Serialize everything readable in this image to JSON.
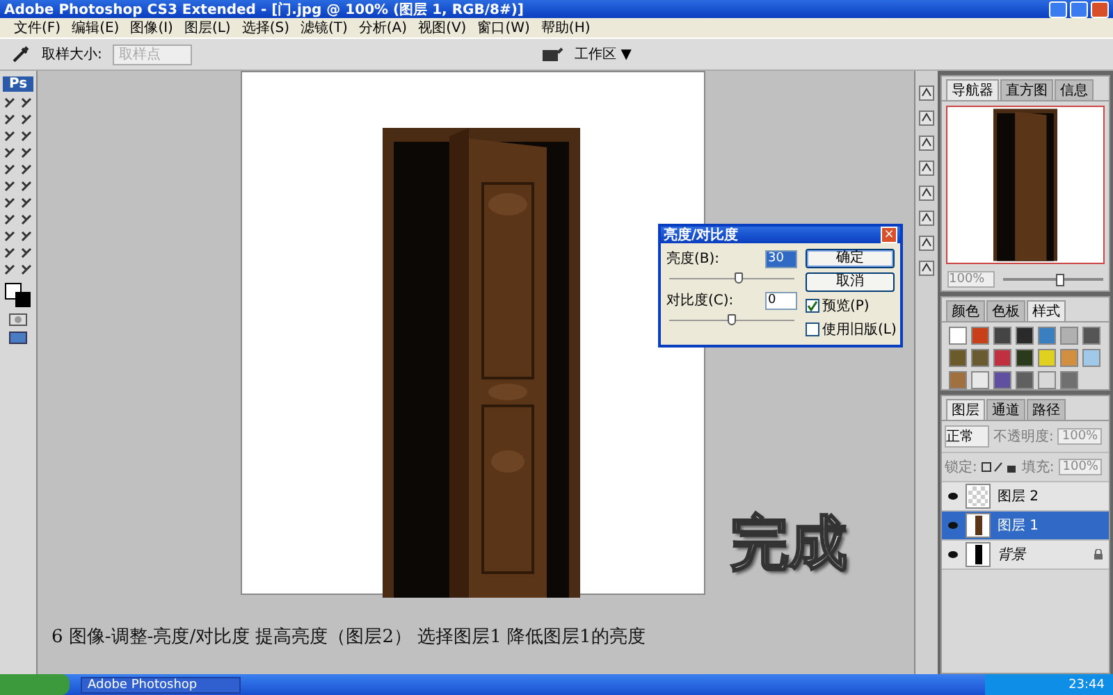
{
  "window": {
    "title": "Adobe Photoshop CS3 Extended - [门.jpg @ 100% (图层 1, RGB/8#)]"
  },
  "menu": [
    "文件(F)",
    "编辑(E)",
    "图像(I)",
    "图层(L)",
    "选择(S)",
    "滤镜(T)",
    "分析(A)",
    "视图(V)",
    "窗口(W)",
    "帮助(H)"
  ],
  "options_bar": {
    "label": "取样大小:",
    "dropdown": {
      "value": "取样点",
      "disabled": true
    },
    "workspace": "工作区 ▼"
  },
  "toolbox": {
    "logo": "Ps"
  },
  "dialog": {
    "title": "亮度/对比度",
    "close": "×",
    "fields": [
      {
        "label": "亮度(B):",
        "value": "30",
        "selected": true,
        "level": 0.55
      },
      {
        "label": "对比度(C):",
        "value": "0",
        "selected": false,
        "level": 0.5
      }
    ],
    "buttons": [
      "确定",
      "取消"
    ],
    "checkboxes": [
      {
        "label": "预览(P)",
        "checked": true
      },
      {
        "label": "使用旧版(L)",
        "checked": false
      }
    ]
  },
  "navigator": {
    "tabs": [
      {
        "label": "导航器",
        "selected": true
      },
      {
        "label": "直方图",
        "selected": false
      },
      {
        "label": "信息",
        "selected": false
      }
    ],
    "zoom": "100%",
    "zoom_slider": {
      "level": 0.55
    }
  },
  "styles": {
    "tabs": [
      {
        "label": "颜色",
        "selected": false
      },
      {
        "label": "色板",
        "selected": false
      },
      {
        "label": "样式",
        "selected": true
      }
    ],
    "swatches": [
      {
        "color": "#ffffff"
      },
      {
        "color": "#c8401a"
      },
      {
        "color": "#444444"
      },
      {
        "color": "#2a2a2a"
      },
      {
        "color": "#3a7fc0"
      },
      {
        "color": "#b0b0b0"
      },
      {
        "color": "#555555"
      },
      {
        "color": "#6b5a2a"
      },
      {
        "color": "#6a5a30"
      },
      {
        "color": "#c03040"
      },
      {
        "color": "#2a3a1a"
      },
      {
        "color": "#e0d020"
      },
      {
        "color": "#d09040"
      },
      {
        "color": "#a0c8e8"
      },
      {
        "color": "#a07040"
      },
      {
        "color": "#e8e8e8"
      },
      {
        "color": "#6050a0"
      },
      {
        "color": "#606060"
      },
      {
        "color": "#d8d8d8"
      },
      {
        "color": "#707070"
      }
    ]
  },
  "layers": {
    "tabs": [
      {
        "label": "图层",
        "selected": true
      },
      {
        "label": "通道",
        "selected": false
      },
      {
        "label": "路径",
        "selected": false
      }
    ],
    "blend_mode": "正常",
    "opacity_label": "不透明度:",
    "opacity": "100%",
    "lock_label": "锁定:",
    "fill_label": "填充:",
    "fill": "100%",
    "items": [
      {
        "name": "图层 2",
        "kind": "transparent",
        "selected": false,
        "locked": false
      },
      {
        "name": "图层 1",
        "kind": "door",
        "selected": true,
        "locked": false
      },
      {
        "name": "背景",
        "kind": "background",
        "selected": false,
        "locked": true
      }
    ]
  },
  "overlay": {
    "caption": "6 图像-调整-亮度/对比度 提高亮度（图层2） 选择图层1 降低图层1的亮度",
    "stamp": "完成"
  },
  "taskbar": {
    "task": "Adobe Photoshop",
    "clock": "23:44"
  }
}
